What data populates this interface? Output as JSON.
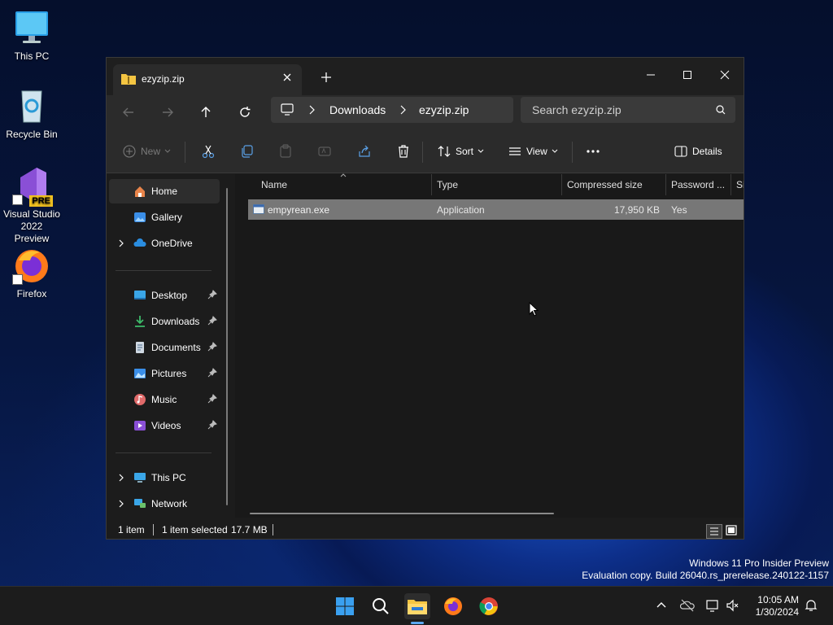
{
  "desktop": {
    "icons": [
      {
        "label": "This PC",
        "icon": "monitor-icon"
      },
      {
        "label": "Recycle Bin",
        "icon": "recycle-bin-icon"
      },
      {
        "label": "Visual Studio 2022 Preview",
        "icon": "visual-studio-icon",
        "badge": "PRE"
      },
      {
        "label": "Firefox",
        "icon": "firefox-icon"
      }
    ],
    "watermark": {
      "line1": "Windows 11 Pro Insider Preview",
      "line2": "Evaluation copy. Build 26040.rs_prerelease.240122-1157"
    }
  },
  "window": {
    "tab_title": "ezyzip.zip",
    "breadcrumb": [
      "Downloads",
      "ezyzip.zip"
    ],
    "search_placeholder": "Search ezyzip.zip",
    "toolbar": {
      "new_label": "New",
      "sort_label": "Sort",
      "view_label": "View",
      "details_label": "Details"
    },
    "nav": {
      "top": [
        {
          "label": "Home",
          "icon": "home-icon",
          "selected": true
        },
        {
          "label": "Gallery",
          "icon": "gallery-icon"
        },
        {
          "label": "OneDrive",
          "icon": "cloud-icon"
        }
      ],
      "pinned": [
        {
          "label": "Desktop",
          "icon": "desktop-folder-icon"
        },
        {
          "label": "Downloads",
          "icon": "download-icon"
        },
        {
          "label": "Documents",
          "icon": "documents-icon"
        },
        {
          "label": "Pictures",
          "icon": "pictures-icon"
        },
        {
          "label": "Music",
          "icon": "music-icon"
        },
        {
          "label": "Videos",
          "icon": "videos-icon"
        }
      ],
      "bottom": [
        {
          "label": "This PC",
          "icon": "monitor-icon"
        },
        {
          "label": "Network",
          "icon": "network-icon"
        }
      ]
    },
    "columns": [
      "Name",
      "Type",
      "Compressed size",
      "Password ...",
      "Si"
    ],
    "files": [
      {
        "name": "empyrean.exe",
        "type": "Application",
        "compressed_size": "17,950 KB",
        "password": "Yes"
      }
    ],
    "status": {
      "count": "1 item",
      "selected": "1 item selected",
      "size": "17.7 MB"
    }
  },
  "taskbar": {
    "apps": [
      "start-icon",
      "search-icon",
      "file-explorer-icon",
      "firefox-icon",
      "chrome-icon"
    ],
    "time": "10:05 AM",
    "date": "1/30/2024"
  },
  "colors": {
    "window_bg": "#1c1c1c",
    "selection": "#777777",
    "accent": "#1f5fd8"
  }
}
